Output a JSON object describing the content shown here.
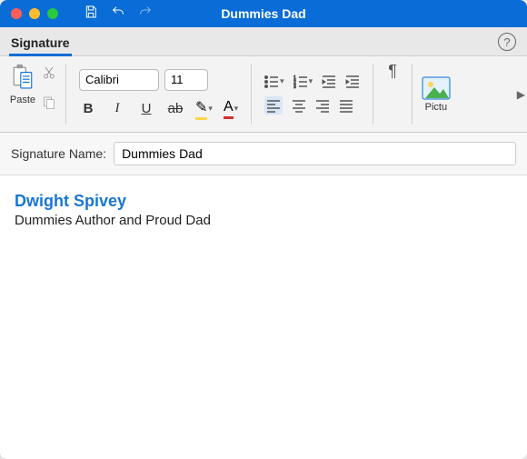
{
  "window": {
    "title": "Dummies Dad"
  },
  "tab": {
    "label": "Signature"
  },
  "ribbon": {
    "paste_label": "Paste",
    "font_name": "Calibri",
    "font_size": "11",
    "bold": "B",
    "italic": "I",
    "underline": "U",
    "strike": "ab",
    "highlight_glyph": "✎",
    "fontcolor_glyph": "A",
    "pilcrow": "¶",
    "picture_label": "Pictu"
  },
  "signature": {
    "name_label": "Signature Name:",
    "name_value": "Dummies Dad",
    "author_name": "Dwight Spivey",
    "author_title": "Dummies Author and Proud Dad"
  },
  "colors": {
    "accent": "#0a6cd6",
    "highlight": "#ffd54f",
    "fontcolor": "#d32f2f",
    "link": "#1976d2"
  }
}
